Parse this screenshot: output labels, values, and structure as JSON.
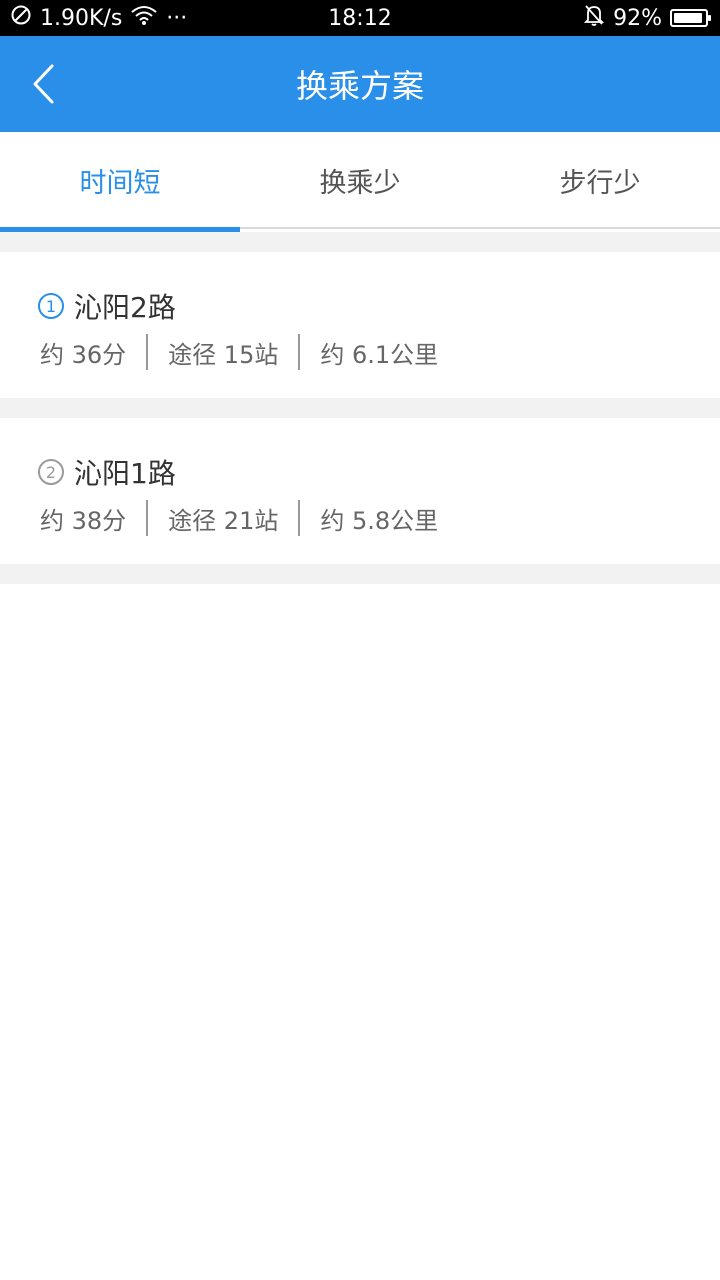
{
  "status_bar": {
    "speed": "1.90K/s",
    "dots": "···",
    "time": "18:12",
    "battery": "92%",
    "battery_level": 0.92
  },
  "header": {
    "title": "换乘方案"
  },
  "tabs": [
    {
      "label": "时间短",
      "active": true
    },
    {
      "label": "换乘少",
      "active": false
    },
    {
      "label": "步行少",
      "active": false
    }
  ],
  "routes": [
    {
      "index": "1",
      "name": "沁阳2路",
      "time": "约 36分",
      "stops": "途径 15站",
      "distance": "约 6.1公里"
    },
    {
      "index": "2",
      "name": "沁阳1路",
      "time": "约 38分",
      "stops": "途径 21站",
      "distance": "约 5.8公里"
    }
  ],
  "colors": {
    "accent": "#2a8fe8",
    "text_dark": "#333333",
    "text_meta": "#666666",
    "gap": "#f2f2f2"
  }
}
